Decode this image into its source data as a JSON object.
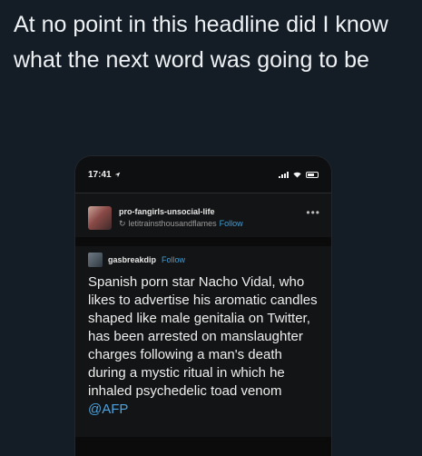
{
  "tweet": {
    "text": "At no point in this headline did I know what the next word was going to be"
  },
  "phone": {
    "status": {
      "time": "17:41"
    },
    "post": {
      "blog_name": "pro-fangirls-unsocial-life",
      "reblogged_from": "letitrainsthousandflames",
      "follow_label": "Follow",
      "reblog_author": "gasbreakdip",
      "reblog_follow_label": "Follow",
      "body": "Spanish porn star Nacho Vidal, who likes to advertise his aromatic candles shaped like male genitalia on Twitter, has been arrested on manslaughter charges following a man's death during a mystic ritual in which he inhaled psychedelic toad venom",
      "mention": "@AFP"
    }
  },
  "colors": {
    "background": "#141d26",
    "link": "#3f9fd8"
  }
}
